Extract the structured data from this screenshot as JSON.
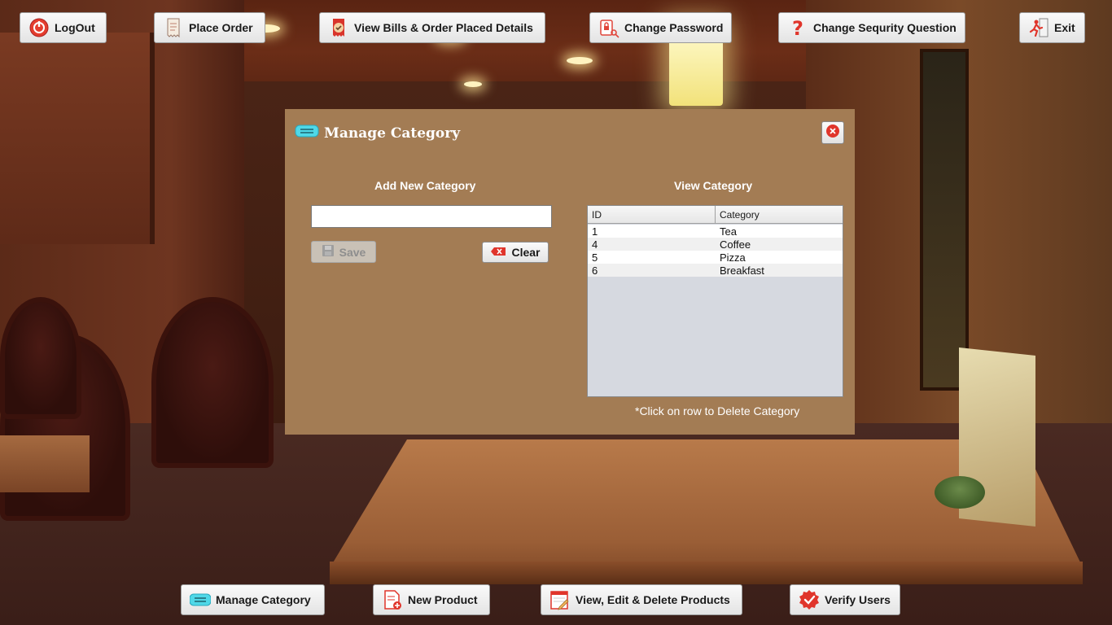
{
  "top_toolbar": {
    "logout": "LogOut",
    "place_order": "Place Order",
    "view_bills": "View Bills & Order Placed Details",
    "change_password": "Change Password",
    "change_security_question": "Change Sequrity Question",
    "exit": "Exit"
  },
  "dialog": {
    "title": "Manage Category",
    "add_section_label": "Add New Category",
    "input_value": "",
    "input_placeholder": "",
    "save_label": "Save",
    "save_enabled": false,
    "clear_label": "Clear",
    "view_section_label": "View Category",
    "table": {
      "columns": [
        "ID",
        "Category"
      ],
      "rows": [
        {
          "id": "1",
          "category": "Tea"
        },
        {
          "id": "4",
          "category": "Coffee"
        },
        {
          "id": "5",
          "category": "Pizza"
        },
        {
          "id": "6",
          "category": "Breakfast"
        }
      ]
    },
    "hint": "*Click on row to Delete Category"
  },
  "bottom_toolbar": {
    "manage_category": "Manage Category",
    "new_product": "New Product",
    "view_edit_delete": "View, Edit & Delete Products",
    "verify_users": "Verify Users"
  },
  "icons": {
    "logout": "power-icon",
    "place_order": "receipt-icon",
    "view_bills": "bill-icon",
    "change_password": "lock-key-icon",
    "change_security_question": "question-icon",
    "exit": "exit-run-icon",
    "manage_category": "category-icon",
    "new_product": "new-document-icon",
    "view_edit_delete": "edit-sheet-icon",
    "verify_users": "verified-check-icon",
    "close": "close-icon",
    "save": "floppy-icon",
    "clear": "eraser-icon"
  },
  "colors": {
    "dialog_bg": "#a37c54",
    "dialog_text": "#ffffff",
    "table_bg": "#d6d9e0",
    "accent_cyan": "#4fd8e8",
    "accent_red": "#e0352b"
  }
}
